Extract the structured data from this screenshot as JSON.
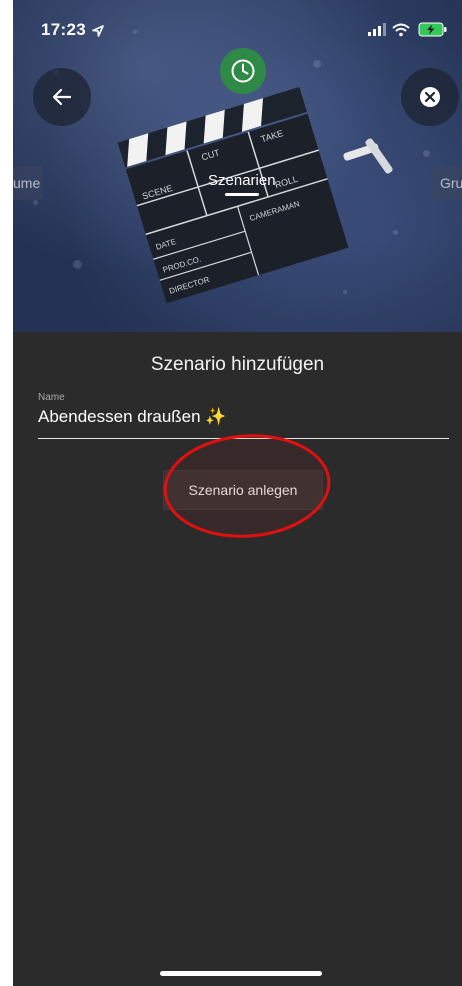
{
  "status_bar": {
    "time": "17:23"
  },
  "hero": {
    "left_tab_partial": "ume",
    "active_tab": "Szenarien",
    "right_tab_partial": "Gru",
    "clapper_words": [
      "SCENE",
      "CUT",
      "TAKE",
      "ROLL",
      "DATE",
      "PROD.CO.",
      "DIRECTOR",
      "CAMERAMAN"
    ]
  },
  "form": {
    "title": "Szenario hinzufügen",
    "name_label": "Name",
    "name_value": "Abendessen draußen ✨",
    "submit_label": "Szenario anlegen"
  },
  "colors": {
    "sheet_background": "#2b2b2b",
    "accent_green": "#2f8a48",
    "annotation_red": "#e0100f"
  },
  "icons": [
    "back-arrow-icon",
    "close-icon",
    "clock-icon",
    "location-arrow-icon",
    "signal-icon",
    "wifi-icon",
    "battery-charging-icon"
  ]
}
